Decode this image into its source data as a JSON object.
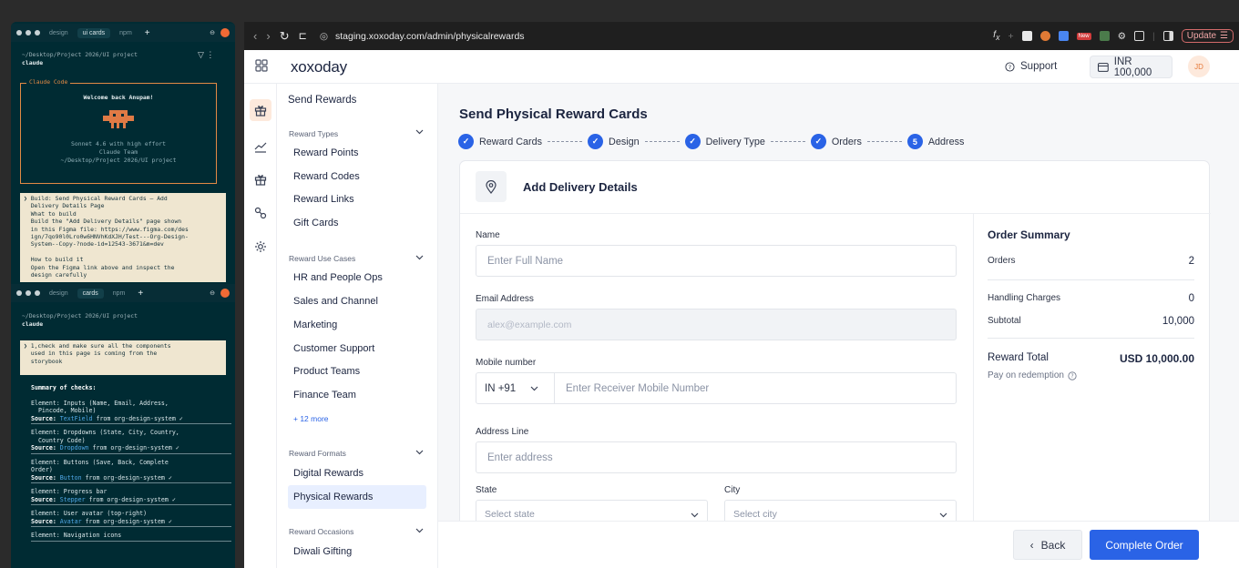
{
  "terminal": {
    "tabs_top": [
      "design",
      "ui cards",
      "npm"
    ],
    "tabs_bottom": [
      "design",
      "cards",
      "npm"
    ],
    "path": "~/Desktop/Project 2026/UI project",
    "user": "claude",
    "box_legend": "Claude Code",
    "welcome": "Welcome back Anupam!",
    "model_line": "Sonnet 4.6 with high effort",
    "team_line": "Claude Team",
    "box_path": "~/Desktop/Project 2026/UI project",
    "prompt1": "❯ Build: Send Physical Reward Cards — Add\n  Delivery Details Page\n  What to build\n  Build the \"Add Delivery Details\" page shown\n  in this Figma file: https://www.figma.com/des\n  ign/7qo90l0Lro0w6HNVhKdXJH/Test---Org-Design-\n  System--Copy-?node-id=12543-3671&m=dev\n\n  How to build it\n  Open the Figma link above and inspect the\n  design carefully",
    "prompt2": "❯ 1,check and make sure all the components\n  used in this page is coming from the\n  storybook",
    "summary_header": "Summary of checks:",
    "checks": [
      {
        "element": "Element: Inputs (Name, Email, Address,\n  Pincode, Mobile)",
        "src_pre": "Source: ",
        "src_key": "TextField",
        "src_post": " from org-design-system ✓"
      },
      {
        "element": "Element: Dropdowns (State, City, Country,\n  Country Code)",
        "src_pre": "Source: ",
        "src_key": "Dropdown",
        "src_post": " from org-design-system ✓"
      },
      {
        "element": "Element: Buttons (Save, Back, Complete\nOrder)",
        "src_pre": "Source: ",
        "src_key": "Button",
        "src_post": " from org-design-system ✓"
      },
      {
        "element": "Element: Progress bar",
        "src_pre": "Source: ",
        "src_key": "Stepper",
        "src_post": " from org-design-system ✓"
      },
      {
        "element": "Element: User avatar (top-right)",
        "src_pre": "Source: ",
        "src_key": "Avatar",
        "src_post": " from org-design-system ✓"
      },
      {
        "element": "Element: Navigation icons",
        "src_pre": "",
        "src_key": "",
        "src_post": ""
      }
    ]
  },
  "browser": {
    "url": "staging.xoxoday.com/admin/physicalrewards",
    "update_label": "Update",
    "new_badge": "New"
  },
  "app": {
    "logo": "xoxoday",
    "support": "Support",
    "balance": "INR 100,000",
    "avatar": "JD"
  },
  "subnav": {
    "top": "Send Rewards",
    "groups": [
      {
        "title": "Reward Types",
        "items": [
          "Reward Points",
          "Reward Codes",
          "Reward Links",
          "Gift Cards"
        ]
      },
      {
        "title": "Reward Use Cases",
        "items": [
          "HR and People Ops",
          "Sales and Channel",
          "Marketing",
          "Customer Support",
          "Product Teams",
          "Finance Team"
        ],
        "more": "+ 12 more"
      },
      {
        "title": "Reward Formats",
        "items": [
          "Digital Rewards",
          "Physical Rewards"
        ]
      },
      {
        "title": "Reward Occasions",
        "items": [
          "Diwali Gifting"
        ]
      }
    ]
  },
  "page": {
    "title": "Send Physical Reward Cards",
    "steps": [
      {
        "label": "Reward Cards",
        "state": "done"
      },
      {
        "label": "Design",
        "state": "done"
      },
      {
        "label": "Delivery Type",
        "state": "done"
      },
      {
        "label": "Orders",
        "state": "done"
      },
      {
        "label": "Address",
        "state": "current",
        "num": "5"
      }
    ],
    "card_title": "Add Delivery Details",
    "form": {
      "name_label": "Name",
      "name_placeholder": "Enter Full Name",
      "email_label": "Email Address",
      "email_value": "alex@example.com",
      "mobile_label": "Mobile number",
      "country_code": "IN +91",
      "mobile_placeholder": "Enter Receiver Mobile Number",
      "address_label": "Address Line",
      "address_placeholder": "Enter address",
      "state_label": "State",
      "state_placeholder": "Select state",
      "city_label": "City",
      "city_placeholder": "Select city"
    },
    "summary": {
      "title": "Order Summary",
      "orders_label": "Orders",
      "orders_value": "2",
      "handling_label": "Handling Charges",
      "handling_value": "0",
      "subtotal_label": "Subtotal",
      "subtotal_value": "10,000",
      "total_label": "Reward Total",
      "total_value": "USD 10,000.00",
      "pay_note": "Pay on redemption"
    },
    "back_label": "Back",
    "complete_label": "Complete Order"
  },
  "colors": {
    "primary": "#2a63e6",
    "accent": "#e57a3c",
    "terminal_bg": "#002b33"
  }
}
